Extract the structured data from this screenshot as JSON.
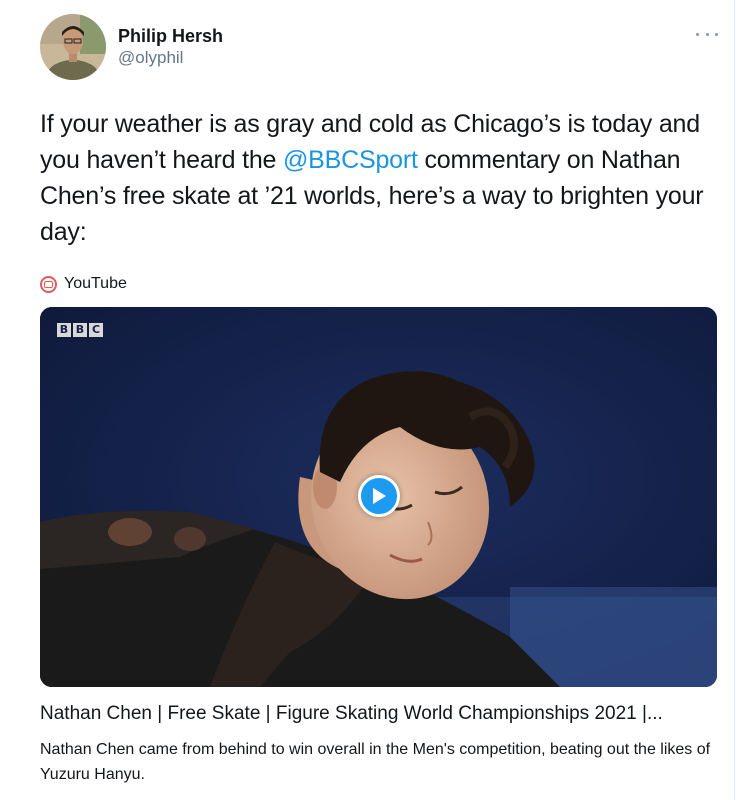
{
  "author": {
    "name": "Philip Hersh",
    "handle": "@olyphil"
  },
  "tweet": {
    "text_before": "If your weather is as gray and cold as Chicago’s is today and you haven’t heard the ",
    "mention": "@BBCSport",
    "text_after": " commentary on Nathan Chen’s free skate at ’21 worlds, here’s a way to brighten your day:"
  },
  "card": {
    "source": "YouTube",
    "watermark": "BBC",
    "title": "Nathan Chen | Free Skate | Figure Skating World Championships 2021 |...",
    "description": "Nathan Chen came from behind to win overall in the Men's competition, beating out the likes of Yuzuru Hanyu."
  },
  "icons": {
    "more": "more-horizontal-icon",
    "source": "youtube-icon",
    "play": "play-icon"
  },
  "colors": {
    "link": "#1b95e0",
    "play_button": "#1d9bf0",
    "video_background": "#13204a",
    "secondary_text": "#657786"
  }
}
